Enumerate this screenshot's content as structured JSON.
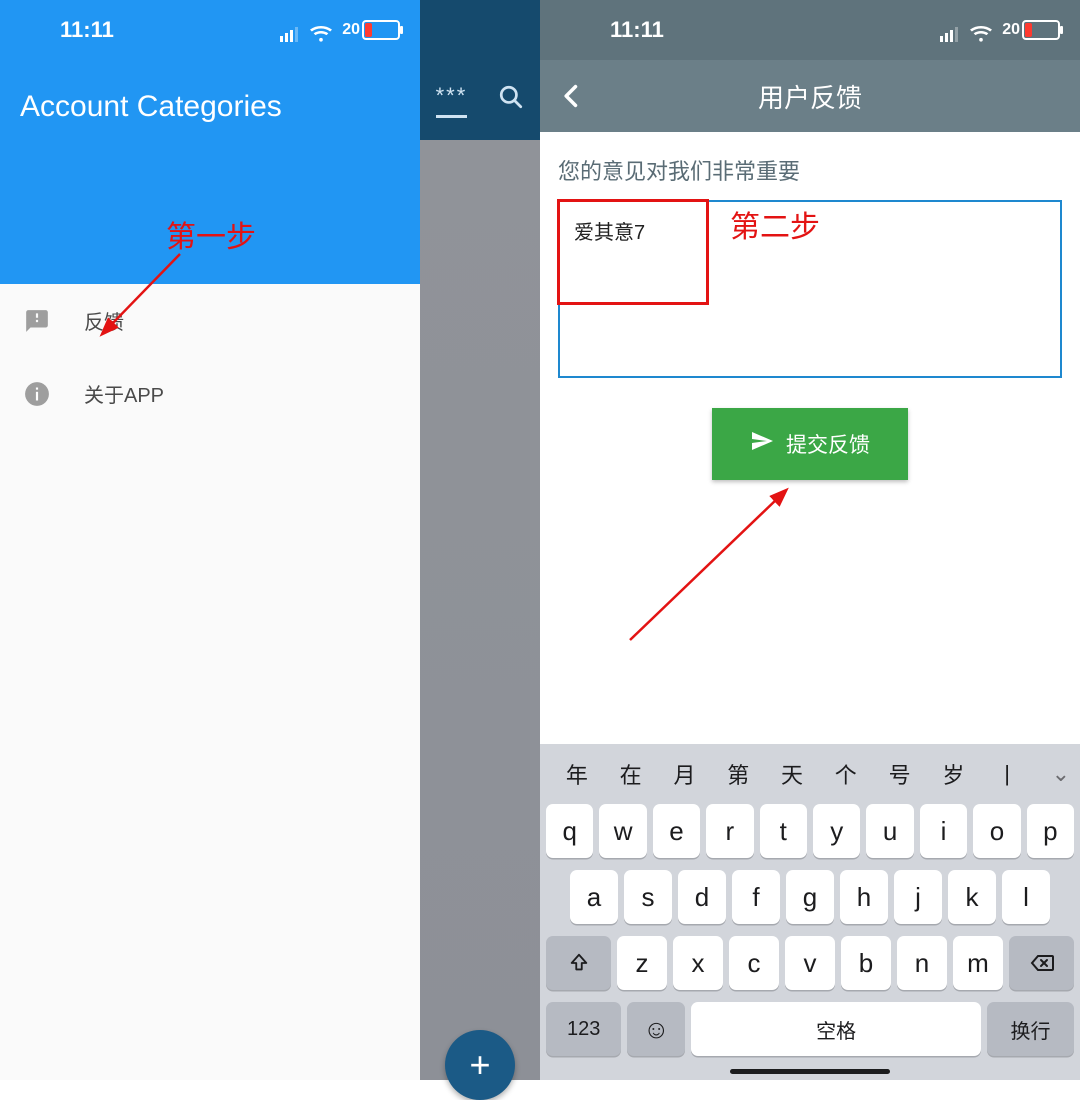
{
  "status": {
    "time": "11:11",
    "battery_percent": "20"
  },
  "left": {
    "title": "Account Categories",
    "menu": [
      {
        "label": "反馈"
      },
      {
        "label": "关于APP"
      }
    ],
    "step_label": "第一步"
  },
  "middle": {
    "asterisks": "***",
    "fab_label": "+"
  },
  "right": {
    "nav_title": "用户反馈",
    "prompt": "您的意见对我们非常重要",
    "textarea_value": "爱其意7",
    "submit_label": "提交反馈",
    "step_label": "第二步"
  },
  "keyboard": {
    "suggestions": [
      "年",
      "在",
      "月",
      "第",
      "天",
      "个",
      "号",
      "岁",
      "|"
    ],
    "row1": [
      "q",
      "w",
      "e",
      "r",
      "t",
      "y",
      "u",
      "i",
      "o",
      "p"
    ],
    "row2": [
      "a",
      "s",
      "d",
      "f",
      "g",
      "h",
      "j",
      "k",
      "l"
    ],
    "row3": [
      "z",
      "x",
      "c",
      "v",
      "b",
      "n",
      "m"
    ],
    "num_key": "123",
    "space_key": "空格",
    "return_key": "换行"
  }
}
